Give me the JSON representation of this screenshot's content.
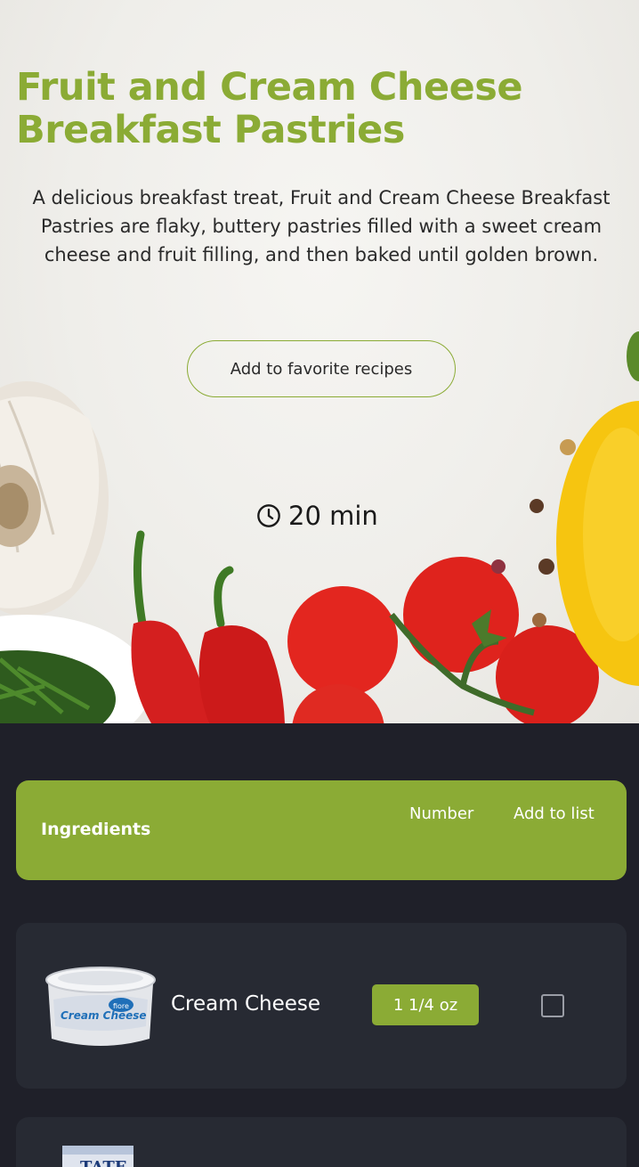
{
  "hero": {
    "title": "Fruit and Cream Cheese Breakfast Pastries",
    "description": "A delicious breakfast treat, Fruit and Cream Cheese Breakfast Pastries are flaky, buttery pastries filled with a sweet cream cheese and fruit filling, and then baked until golden brown.",
    "favorite_button": "Add to favorite recipes",
    "time": "20 min",
    "time_icon": "clock-icon"
  },
  "ingredients": {
    "header": {
      "title": "Ingredients",
      "number_label": "Number",
      "add_label": "Add to list"
    },
    "items": [
      {
        "name": "Cream Cheese",
        "quantity": "1 1/4 oz",
        "checked": false,
        "product_text": "Cream Cheese",
        "brand": "fiore"
      },
      {
        "name": "",
        "quantity": "",
        "product_text": "TATE"
      }
    ]
  },
  "colors": {
    "accent": "#8bab35",
    "dark_bg": "#1f2029",
    "card_bg": "#272a33"
  }
}
